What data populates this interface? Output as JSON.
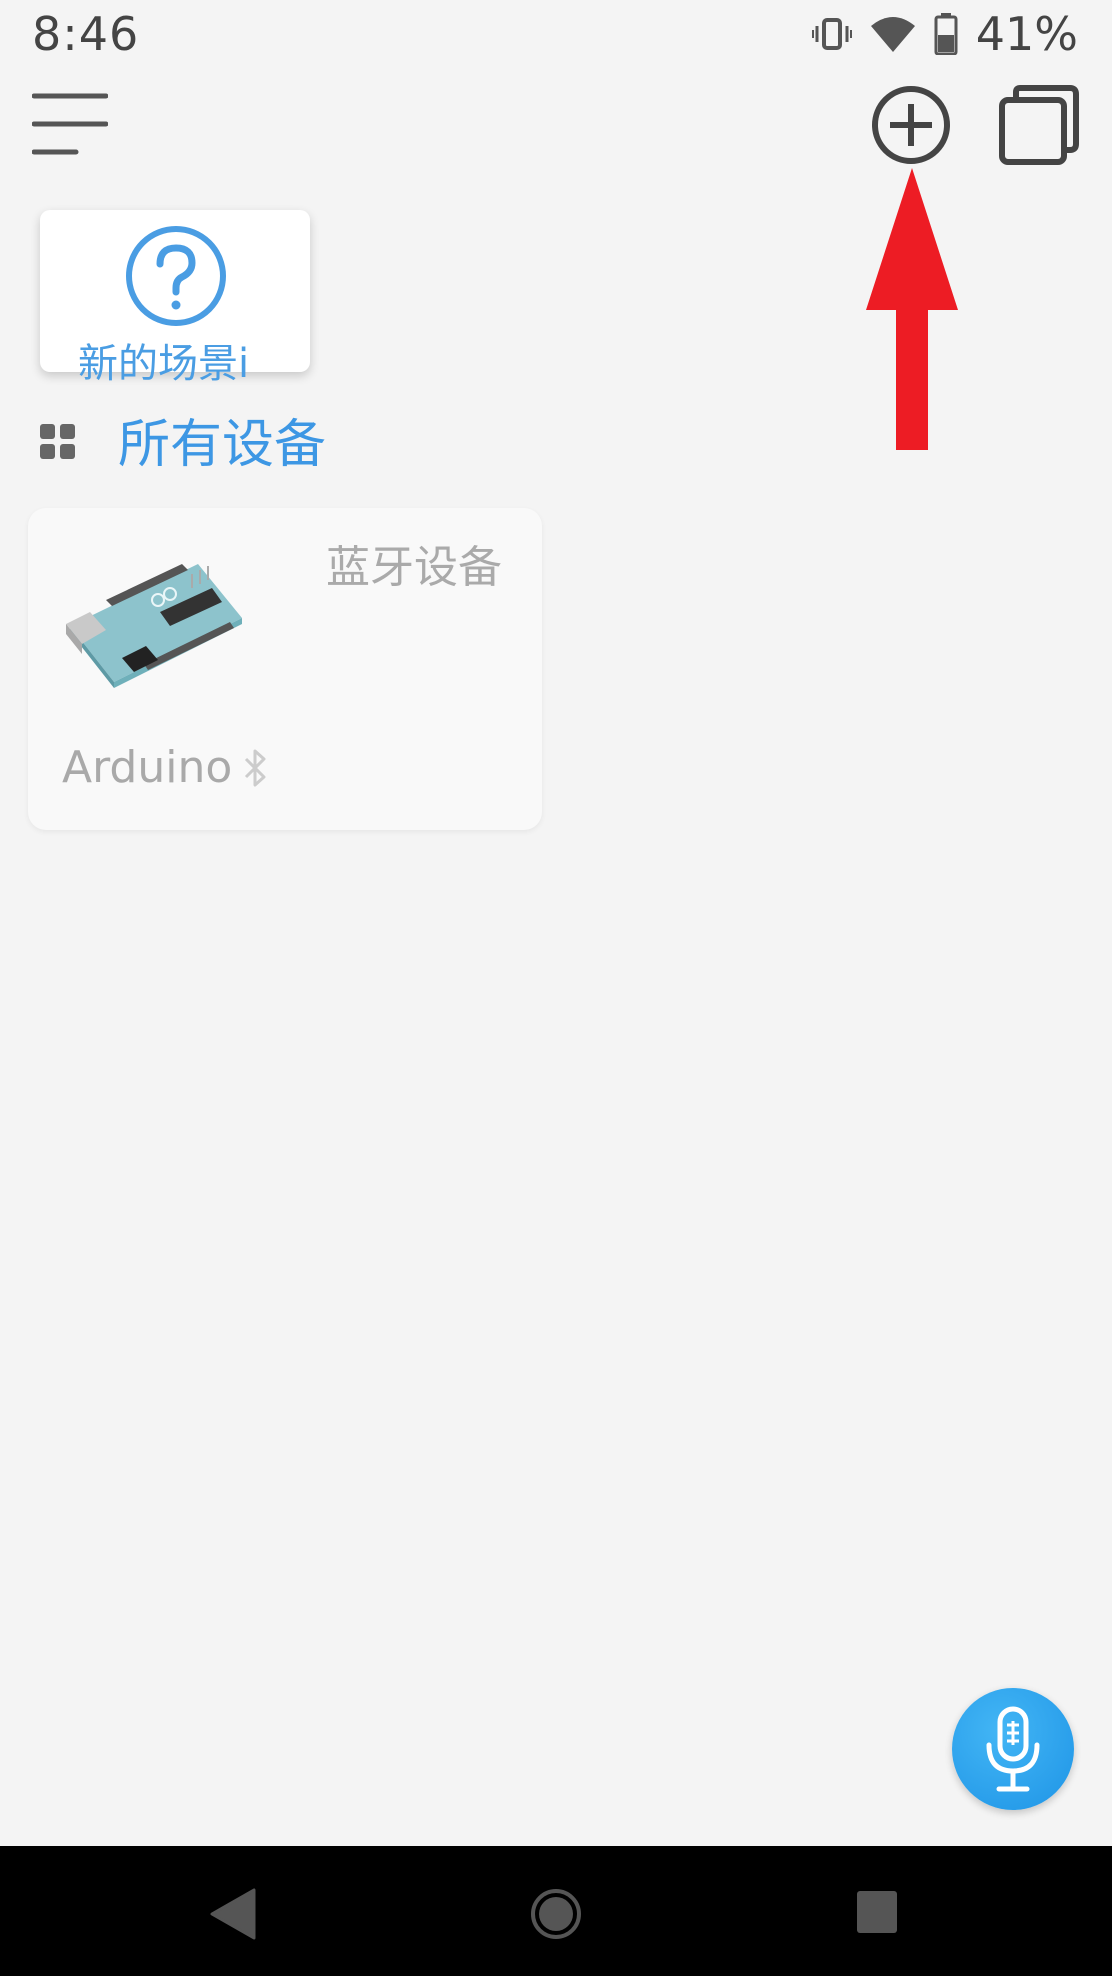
{
  "status_bar": {
    "time": "8:46",
    "battery_percent": "41%",
    "icons": [
      "vibrate-icon",
      "wifi-icon",
      "battery-icon"
    ]
  },
  "toolbar": {
    "icons": [
      "menu-icon",
      "add-circle-icon",
      "overlay-icon"
    ]
  },
  "scene": {
    "label": "新的场景i",
    "icon": "question-circle-icon"
  },
  "section": {
    "title": "所有设备",
    "icon": "grid-icon"
  },
  "device": {
    "type_label": "蓝牙设备",
    "name": "Arduino",
    "icon": "bluetooth-icon",
    "image": "arduino-board-image"
  },
  "fab": {
    "icon": "microphone-icon"
  },
  "nav": {
    "icons": [
      "back-icon",
      "home-icon",
      "recents-icon"
    ]
  },
  "colors": {
    "accent": "#3d97e4",
    "background": "#f4f4f4",
    "annotation_arrow": "#ed1c24",
    "fab": "#2aa4ee",
    "nav_bar": "#000000"
  }
}
